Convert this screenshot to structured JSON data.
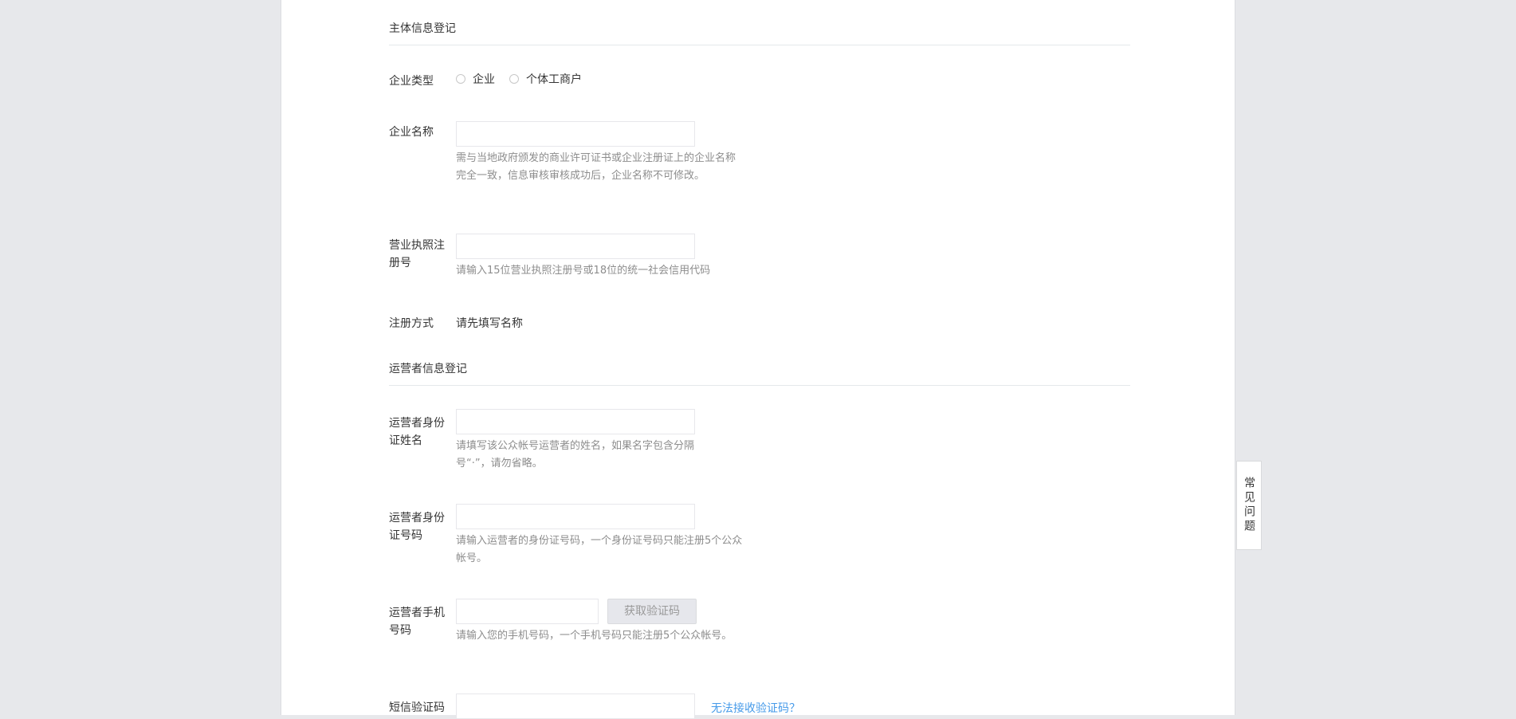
{
  "entity_section": {
    "title": "主体信息登记",
    "company_type": {
      "label": "企业类型",
      "options": [
        "企业",
        "个体工商户"
      ]
    },
    "company_name": {
      "label": "企业名称",
      "value": "",
      "tip": "需与当地政府颁发的商业许可证书或企业注册证上的企业名称完全一致，信息审核审核成功后，企业名称不可修改。"
    },
    "license_no": {
      "label": "营业执照注册号",
      "value": "",
      "tip": "请输入15位营业执照注册号或18位的统一社会信用代码"
    },
    "register_method": {
      "label": "注册方式",
      "value": "请先填写名称"
    }
  },
  "operator_section": {
    "title": "运营者信息登记",
    "id_name": {
      "label": "运营者身份证姓名",
      "value": "",
      "tip": "请填写该公众帐号运营者的姓名，如果名字包含分隔号“·”，请勿省略。"
    },
    "id_number": {
      "label": "运营者身份证号码",
      "value": "",
      "tip": "请输入运营者的身份证号码，一个身份证号码只能注册5个公众帐号。"
    },
    "phone": {
      "label": "运营者手机号码",
      "value": "",
      "get_code_button": "获取验证码",
      "tip": "请输入您的手机号码，一个手机号码只能注册5个公众帐号。"
    },
    "sms_code": {
      "label": "短信验证码",
      "value": "",
      "help_link": "无法接收验证码？"
    }
  },
  "faq_button": "常见问题"
}
